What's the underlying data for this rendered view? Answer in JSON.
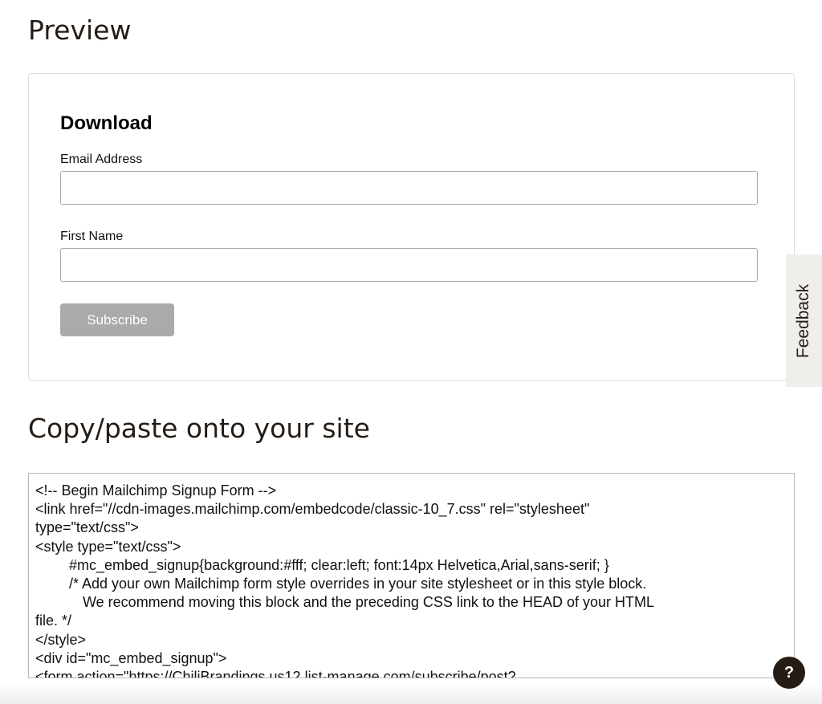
{
  "preview": {
    "heading": "Preview",
    "form": {
      "title": "Download",
      "email_label": "Email Address",
      "email_value": "",
      "first_name_label": "First Name",
      "first_name_value": "",
      "subscribe_label": "Subscribe"
    }
  },
  "feedback": {
    "label": "Feedback"
  },
  "copy": {
    "heading": "Copy/paste onto your site",
    "code_lines": [
      "<!-- Begin Mailchimp Signup Form -->",
      "<link href=\"//cdn-images.mailchimp.com/embedcode/classic-10_7.css\" rel=\"stylesheet\"",
      "type=\"text/css\">",
      "<style type=\"text/css\">",
      "#mc_embed_signup{background:#fff; clear:left; font:14px Helvetica,Arial,sans-serif; }",
      "/* Add your own Mailchimp form style overrides in your site stylesheet or in this style block.",
      "We recommend moving this block and the preceding CSS link to the HEAD of your HTML",
      "file. */",
      "</style>",
      "<div id=\"mc_embed_signup\">",
      "<form action=\"https://ChiliBrandings.us12.list-manage.com/subscribe/post?"
    ]
  },
  "help": {
    "label": "?"
  },
  "colors": {
    "text": "#241c15",
    "button_disabled": "#aaaaaa",
    "feedback_bg": "#efeeea",
    "help_bg": "#241c15"
  }
}
